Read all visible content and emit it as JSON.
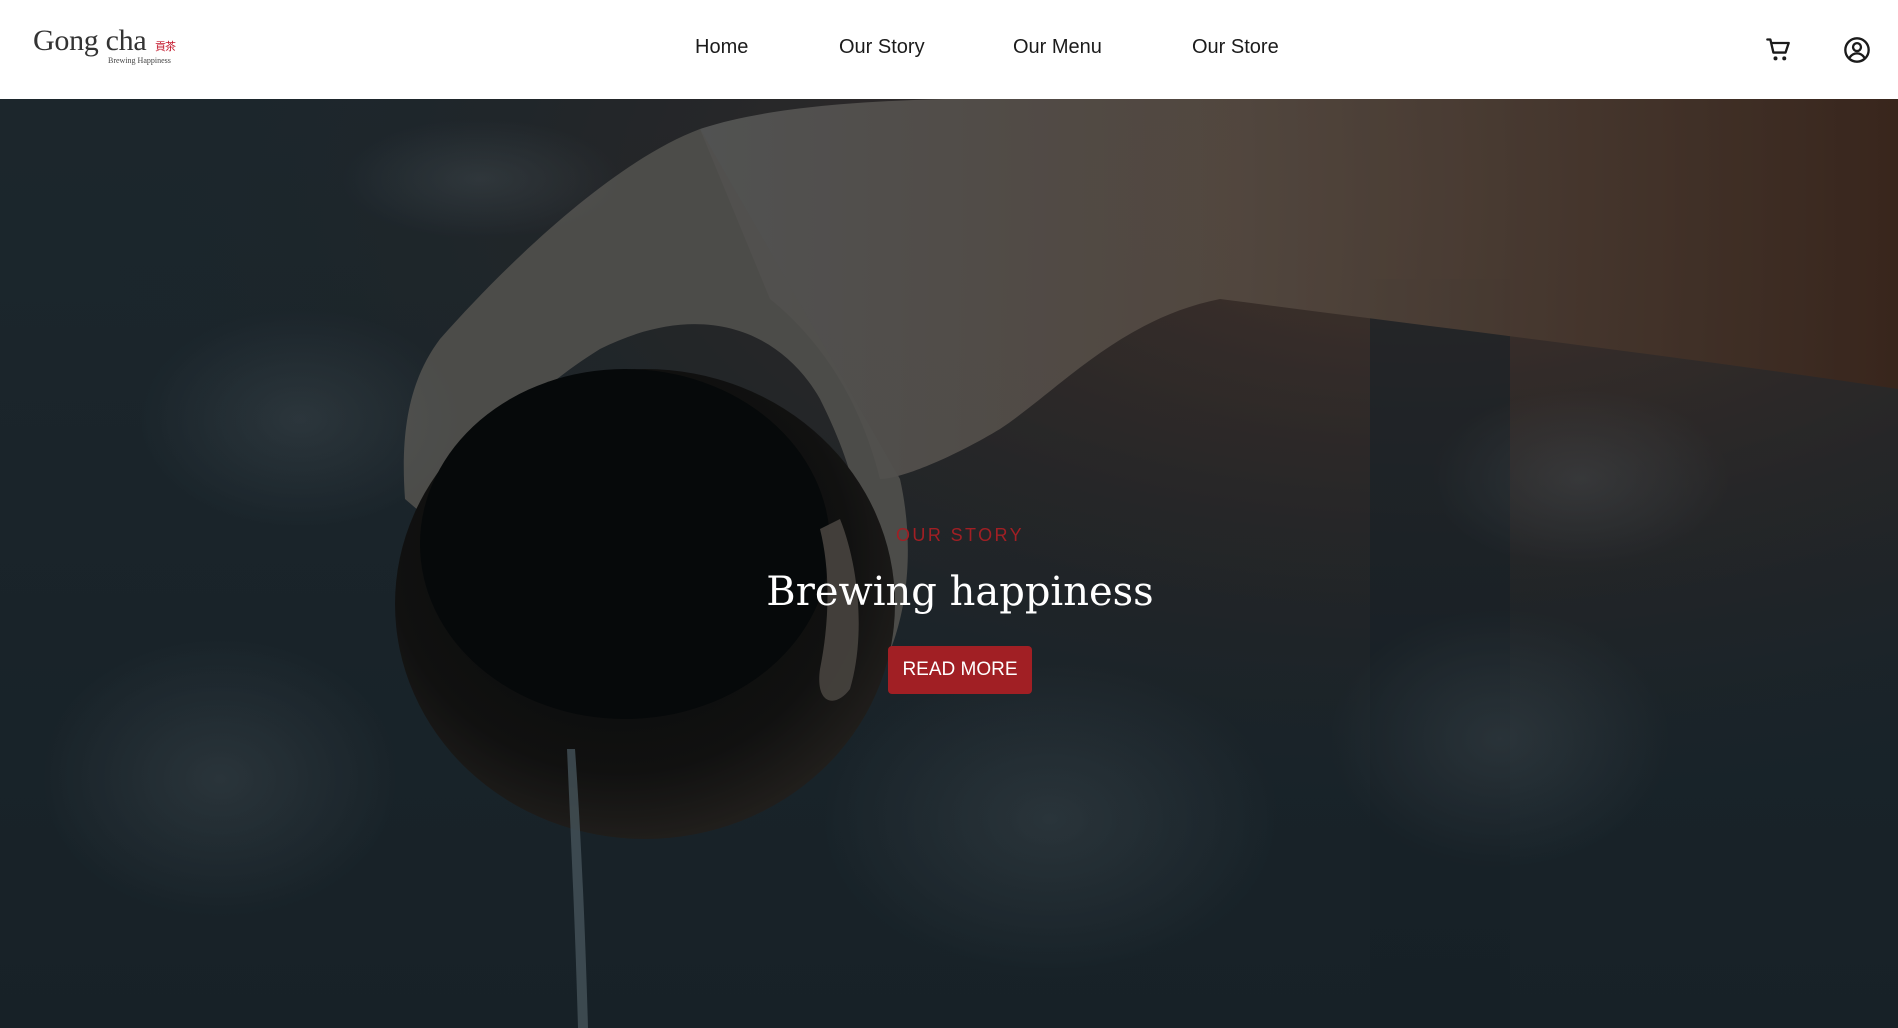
{
  "brand": {
    "name": "Gong cha",
    "cjk": "貢茶",
    "tagline": "Brewing Happiness"
  },
  "nav": {
    "items": [
      {
        "label": "Home"
      },
      {
        "label": "Our Story"
      },
      {
        "label": "Our Menu"
      },
      {
        "label": "Our Store"
      }
    ]
  },
  "header_icons": {
    "cart": "cart-icon",
    "account": "account-icon"
  },
  "hero": {
    "eyebrow": "OUR STORY",
    "title": "Brewing happiness",
    "cta_label": "READ MORE"
  },
  "colors": {
    "accent": "#a11f24",
    "header_bg": "#ffffff",
    "hero_bg": "#1e2830",
    "nav_text": "#1b1b1b"
  }
}
